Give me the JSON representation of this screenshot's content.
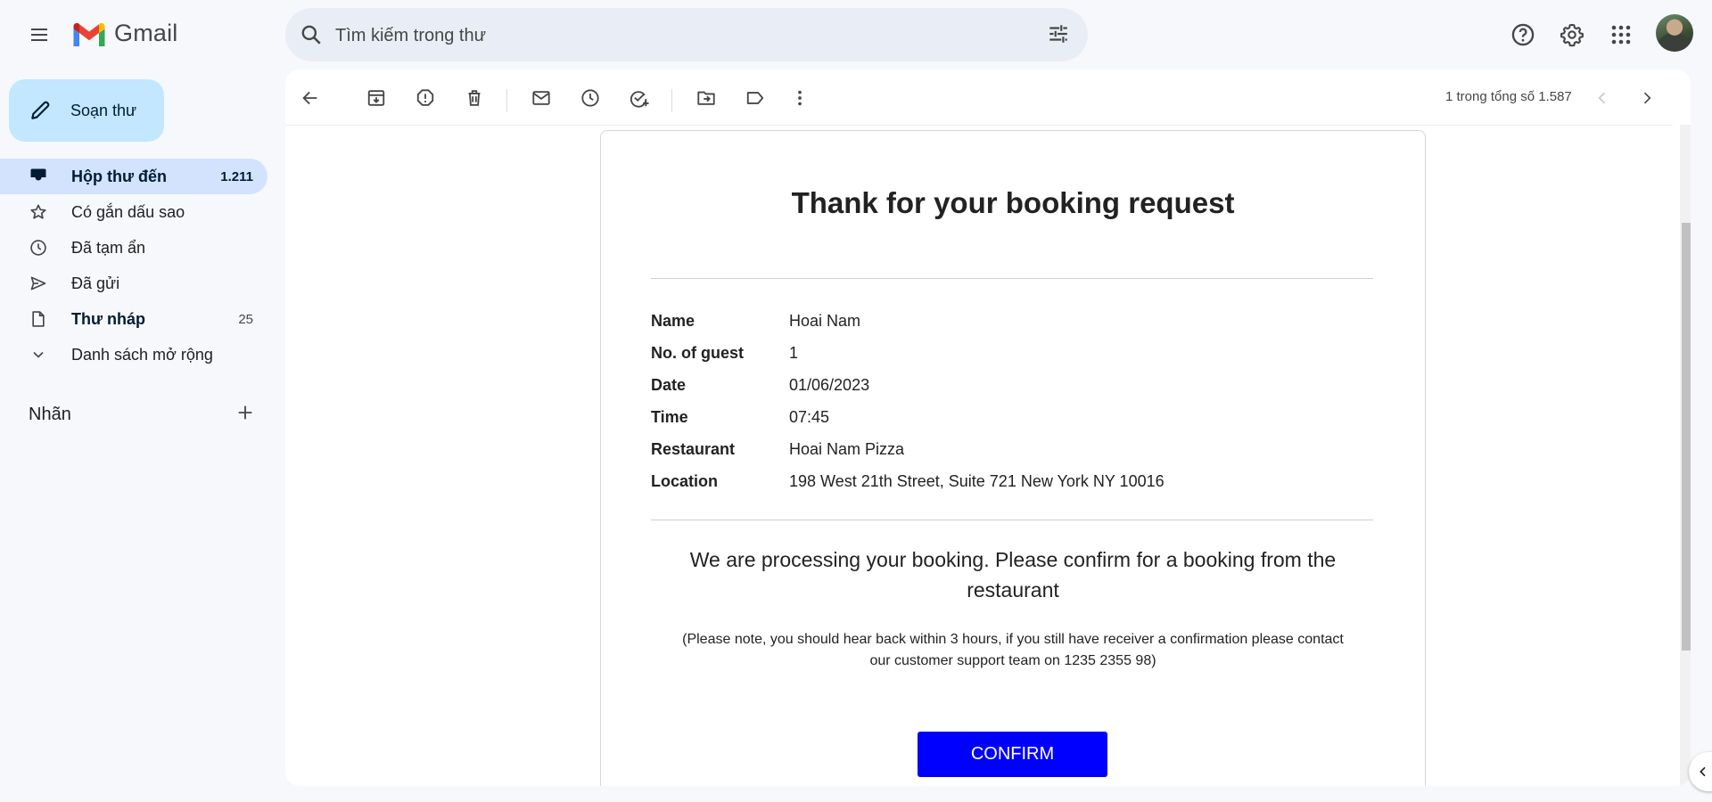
{
  "app": {
    "name": "Gmail"
  },
  "search": {
    "placeholder": "Tìm kiếm trong thư"
  },
  "sidebar": {
    "compose_label": "Soạn thư",
    "items": [
      {
        "label": "Hộp thư đến",
        "count": "1.211",
        "icon": "inbox-icon"
      },
      {
        "label": "Có gắn dấu sao",
        "count": "",
        "icon": "star-icon"
      },
      {
        "label": "Đã tạm ẩn",
        "count": "",
        "icon": "clock-icon"
      },
      {
        "label": "Đã gửi",
        "count": "",
        "icon": "send-icon"
      },
      {
        "label": "Thư nháp",
        "count": "25",
        "icon": "draft-icon"
      },
      {
        "label": "Danh sách mở rộng",
        "count": "",
        "icon": "chevron-down-icon"
      }
    ],
    "labels_title": "Nhãn"
  },
  "toolbar": {
    "pager": "1 trong tổng số 1.587"
  },
  "email": {
    "title": "Thank for your booking request",
    "details": [
      {
        "key": "Name",
        "value": "Hoai Nam"
      },
      {
        "key": "No. of guest",
        "value": "1"
      },
      {
        "key": "Date",
        "value": "01/06/2023"
      },
      {
        "key": "Time",
        "value": "07:45"
      },
      {
        "key": "Restaurant",
        "value": "Hoai Nam Pizza"
      },
      {
        "key": "Location",
        "value": "198 West 21th Street, Suite 721 New York NY 10016"
      }
    ],
    "processing": "We are processing your booking. Please confirm for a booking from the restaurant",
    "note": "(Please note, you should hear back within 3 hours, if you still have receiver a confirmation please contact our customer support team on 1235 2355 98)",
    "confirm_label": "CONFIRM"
  },
  "colors": {
    "confirm_button": "#0000ff",
    "active_nav": "#d3e3fd",
    "compose": "#c2e7ff",
    "search_bg": "#e9eef6"
  }
}
